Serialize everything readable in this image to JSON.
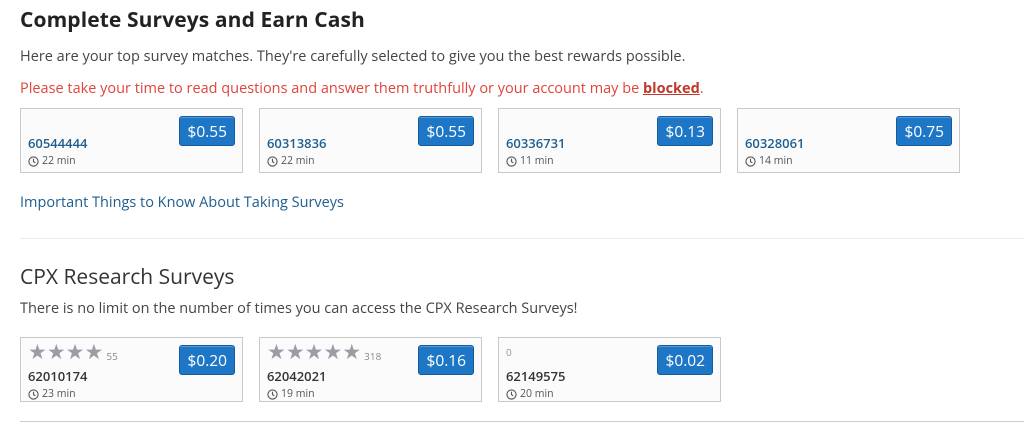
{
  "header": {
    "title": "Complete Surveys and Earn Cash",
    "intro": "Here are your top survey matches. They're carefully selected to give you the best rewards possible.",
    "warning_text": "Please take your time to read questions and answer them truthfully or your account may be ",
    "warning_link": "blocked",
    "warning_end": "."
  },
  "top_surveys": [
    {
      "id": "60544444",
      "payout": "$0.55",
      "duration": "22 min"
    },
    {
      "id": "60313836",
      "payout": "$0.55",
      "duration": "22 min"
    },
    {
      "id": "60336731",
      "payout": "$0.13",
      "duration": "11 min"
    },
    {
      "id": "60328061",
      "payout": "$0.75",
      "duration": "14 min"
    }
  ],
  "info_link": "Important Things to Know About Taking Surveys",
  "cpx": {
    "title": "CPX Research Surveys",
    "description": "There is no limit on the number of times you can access the CPX Research Surveys!",
    "surveys": [
      {
        "id": "62010174",
        "payout": "$0.20",
        "duration": "23 min",
        "stars": 4,
        "rating_count": "55"
      },
      {
        "id": "62042021",
        "payout": "$0.16",
        "duration": "19 min",
        "stars": 5,
        "rating_count": "318"
      },
      {
        "id": "62149575",
        "payout": "$0.02",
        "duration": "20 min",
        "stars": 0,
        "rating_count": "0"
      }
    ]
  },
  "icons": {
    "clock": "clock-icon",
    "star": "star-icon"
  },
  "colors": {
    "accent": "#1e76c6",
    "link": "#1d5d8f",
    "warning": "#e0443a",
    "star": "#999ea6"
  }
}
